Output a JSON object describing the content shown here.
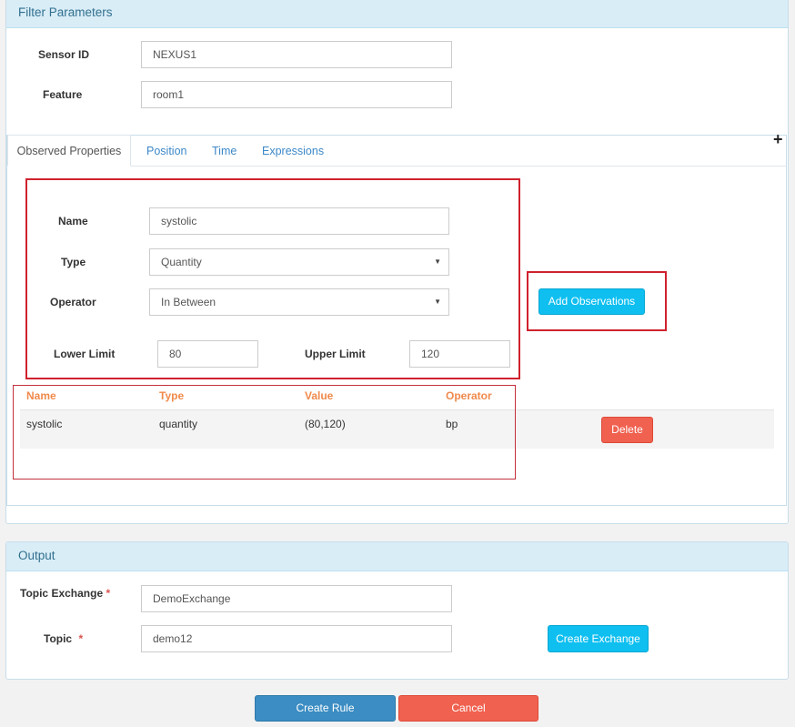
{
  "filter": {
    "title": "Filter Parameters",
    "sensor_id_label": "Sensor ID",
    "sensor_id_value": "NEXUS1",
    "feature_label": "Feature",
    "feature_value": "room1"
  },
  "tabs": [
    {
      "label": "Observed Properties",
      "active": true
    },
    {
      "label": "Position"
    },
    {
      "label": "Time"
    },
    {
      "label": "Expressions"
    }
  ],
  "add_tab_icon": "+",
  "observation_form": {
    "name_label": "Name",
    "name_value": "systolic",
    "type_label": "Type",
    "type_value": "Quantity",
    "operator_label": "Operator",
    "operator_value": "In Between",
    "lower_limit_label": "Lower Limit",
    "lower_limit_value": "80",
    "upper_limit_label": "Upper Limit",
    "upper_limit_value": "120",
    "add_button": "Add Observations"
  },
  "obs_table": {
    "headers": [
      "Name",
      "Type",
      "Value",
      "Operator"
    ],
    "rows": [
      {
        "name": "systolic",
        "type": "quantity",
        "value": "(80,120)",
        "operator": "bp",
        "action": "Delete"
      }
    ]
  },
  "output": {
    "title": "Output",
    "topic_exchange_label": "Topic Exchange",
    "topic_exchange_value": "DemoExchange",
    "topic_label": "Topic",
    "topic_value": "demo12",
    "required_mark": "*",
    "create_exchange_button": "Create Exchange"
  },
  "footer": {
    "create_rule_button": "Create Rule",
    "cancel_button": "Cancel"
  },
  "colors": {
    "accent": "#0ebff0",
    "danger": "#f0614f",
    "primary": "#3b8dc3",
    "annotation": "#d0222e"
  }
}
